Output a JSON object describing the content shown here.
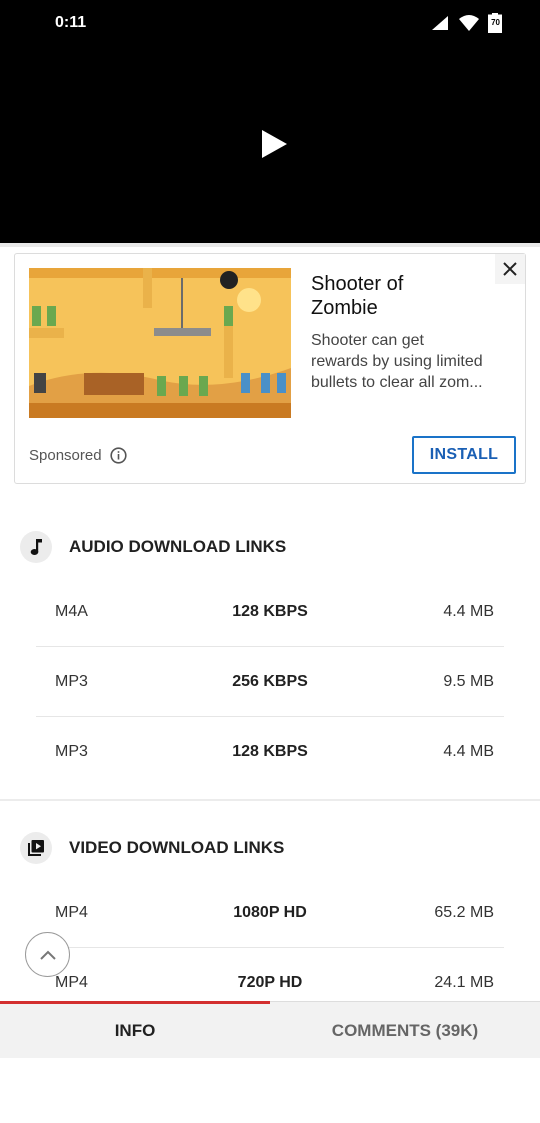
{
  "status_bar": {
    "time": "0:11",
    "battery": "70"
  },
  "player": {
    "play_icon": "play-icon"
  },
  "ad": {
    "title_line1": "Shooter of",
    "title_line2": "Zombie",
    "desc_line1": "Shooter can get",
    "desc_line2": "rewards by using limited",
    "desc_line3": "bullets to clear all zom...",
    "sponsored": "Sponsored",
    "install": "INSTALL"
  },
  "audio": {
    "title": "AUDIO DOWNLOAD LINKS",
    "rows": [
      {
        "format": "M4A",
        "quality": "128 KBPS",
        "size": "4.4 MB"
      },
      {
        "format": "MP3",
        "quality": "256 KBPS",
        "size": "9.5 MB"
      },
      {
        "format": "MP3",
        "quality": "128 KBPS",
        "size": "4.4 MB"
      }
    ]
  },
  "video": {
    "title": "VIDEO DOWNLOAD LINKS",
    "rows": [
      {
        "format": "MP4",
        "quality": "1080P HD",
        "size": "65.2 MB"
      },
      {
        "format": "MP4",
        "quality": "720P HD",
        "size": "24.1 MB"
      }
    ]
  },
  "tabs": {
    "info": "INFO",
    "comments": "COMMENTS (39K)"
  },
  "colors": {
    "install_blue": "#1a5fb4",
    "tab_indicator": "#d32f2f"
  }
}
